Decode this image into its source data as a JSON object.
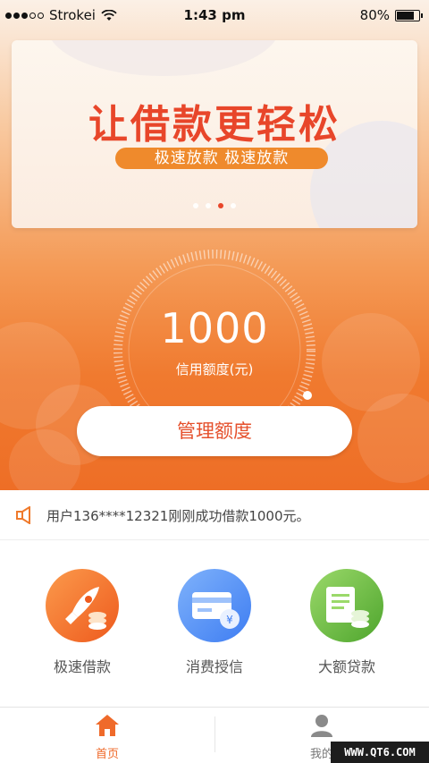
{
  "status_bar": {
    "carrier": "Strokei",
    "time": "1:43 pm",
    "battery": "80%"
  },
  "banner": {
    "title": "让借款更轻松",
    "subtitle": "极速放款  极速放款",
    "page_count": 4,
    "active_page": 3
  },
  "credit": {
    "amount": "1000",
    "label": "信用额度(元)",
    "manage_label": "管理额度"
  },
  "notice": {
    "text": "用户136****12321刚刚成功借款1000元。"
  },
  "services": [
    {
      "label": "极速借款",
      "icon": "rocket-coins-icon",
      "color": "#f2702c"
    },
    {
      "label": "消费授信",
      "icon": "card-moneybag-icon",
      "color": "#4f8cf5"
    },
    {
      "label": "大额贷款",
      "icon": "document-coins-icon",
      "color": "#63b93b"
    }
  ],
  "tabbar": {
    "home_label": "首页",
    "mine_label": "我的",
    "active_color": "#ef6a2a",
    "inactive_color": "#777777"
  },
  "watermark": "WWW.QT6.COM",
  "colors": {
    "accent": "#e8462a",
    "orange": "#ef6a2a"
  }
}
